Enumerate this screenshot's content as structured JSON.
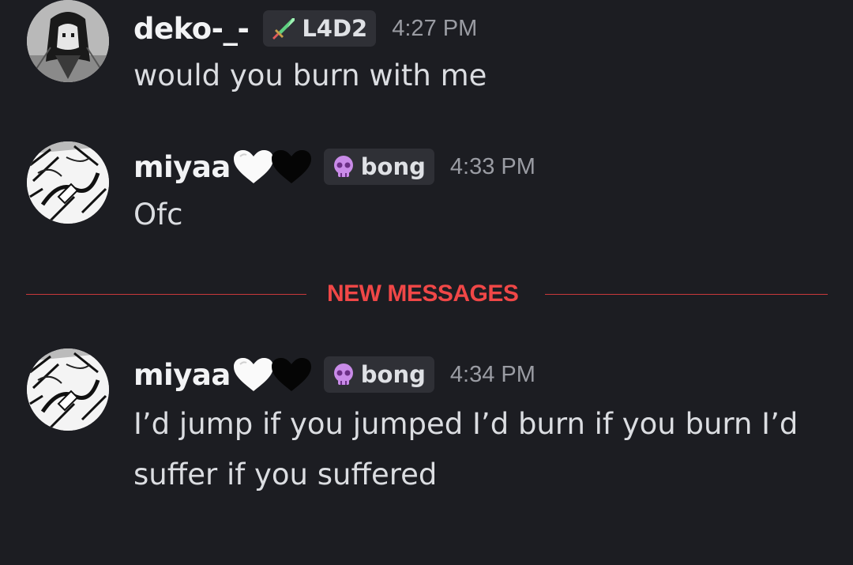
{
  "messages": [
    {
      "username": "deko-_-",
      "tag": {
        "icon": "sword-icon",
        "label": "L4D2"
      },
      "time": "4:27 PM",
      "text": "would you burn with me"
    },
    {
      "username": "miyaa",
      "username_suffix_icons": [
        "white-heart-icon",
        "black-heart-icon"
      ],
      "tag": {
        "icon": "skull-icon",
        "label": "bong"
      },
      "time": "4:33 PM",
      "text": "Ofc"
    },
    {
      "username": "miyaa",
      "username_suffix_icons": [
        "white-heart-icon",
        "black-heart-icon"
      ],
      "tag": {
        "icon": "skull-icon",
        "label": "bong"
      },
      "time": "4:34 PM",
      "text": "I’d jump if you jumped I’d burn if you burn I’d suffer if you suffered"
    }
  ],
  "divider": {
    "label": "NEW MESSAGES"
  },
  "colors": {
    "background": "#1c1d22",
    "username": "#f2f3f5",
    "message_text": "#dbdde1",
    "timestamp": "#9a9ca3",
    "tag_background": "#2f3036",
    "new_messages_accent": "#f04747"
  }
}
